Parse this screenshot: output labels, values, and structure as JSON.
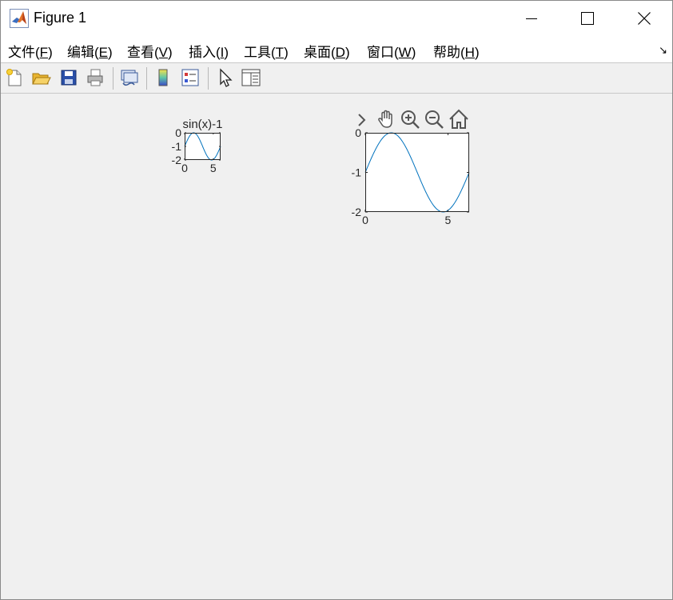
{
  "window": {
    "title": "Figure 1",
    "icon": "matlab-logo-icon",
    "controls": [
      "minimize-icon",
      "maximize-icon",
      "close-icon"
    ]
  },
  "menubar": {
    "items": [
      {
        "label": "文件(F)",
        "underline": "F"
      },
      {
        "label": "编辑(E)",
        "underline": "E"
      },
      {
        "label": "查看(V)",
        "underline": "V"
      },
      {
        "label": "插入(I)",
        "underline": "I"
      },
      {
        "label": "工具(T)",
        "underline": "T"
      },
      {
        "label": "桌面(D)",
        "underline": "D"
      },
      {
        "label": "窗口(W)",
        "underline": "W"
      },
      {
        "label": "帮助(H)",
        "underline": "H"
      }
    ],
    "dock_arrow": "↘"
  },
  "toolbar": {
    "buttons": [
      {
        "name": "new-figure",
        "icon": "new-file-icon"
      },
      {
        "name": "open-file",
        "icon": "folder-open-icon"
      },
      {
        "name": "save-figure",
        "icon": "save-icon"
      },
      {
        "name": "print-figure",
        "icon": "print-icon"
      },
      {
        "name": "link-plot",
        "icon": "link-plot-icon"
      },
      {
        "name": "insert-colorbar",
        "icon": "colorbar-icon"
      },
      {
        "name": "insert-legend",
        "icon": "legend-icon"
      },
      {
        "name": "edit-plot",
        "icon": "pointer-icon"
      },
      {
        "name": "property-inspector",
        "icon": "property-inspector-icon"
      }
    ]
  },
  "axes_toolbar": {
    "icons": [
      "chevron-right-icon",
      "pan-hand-icon",
      "zoom-in-icon",
      "zoom-out-icon",
      "home-icon"
    ]
  },
  "colors": {
    "line": "#0072bd",
    "axes_bg": "#ffffff",
    "figure_bg": "#f0f0f0",
    "axis_text": "#262626"
  },
  "chart_data": [
    {
      "type": "line",
      "title": "sin(x)-1",
      "xlabel": "",
      "ylabel": "",
      "xlim": [
        0,
        6.2832
      ],
      "ylim": [
        -2,
        0
      ],
      "xticks": [
        0,
        5
      ],
      "yticks": [
        0,
        -1,
        -2
      ],
      "xtick_labels": [
        "0",
        "5"
      ],
      "ytick_labels": [
        "0",
        "-1",
        "-2"
      ],
      "grid": false,
      "series": [
        {
          "function": "y = sin(x) - 1",
          "x": [
            0,
            0.5,
            1.0,
            1.5708,
            2.0,
            2.5,
            3.0,
            3.5,
            4.0,
            4.7124,
            5.0,
            5.5,
            6.0,
            6.2832
          ],
          "y": [
            -1.0,
            -0.5206,
            -0.1585,
            0.0,
            -0.0907,
            -0.4015,
            -0.8589,
            -1.3508,
            -1.7568,
            -2.0,
            -1.9589,
            -1.7055,
            -1.2794,
            -1.0
          ]
        }
      ]
    },
    {
      "type": "line",
      "title": "",
      "xlabel": "",
      "ylabel": "",
      "xlim": [
        0,
        6.2832
      ],
      "ylim": [
        -2,
        0
      ],
      "xticks": [
        0,
        5
      ],
      "yticks": [
        0,
        -1,
        -2
      ],
      "xtick_labels": [
        "0",
        "5"
      ],
      "ytick_labels": [
        "0",
        "-1",
        "-2"
      ],
      "grid": false,
      "series": [
        {
          "function": "y = sin(x) - 1",
          "x": [
            0,
            0.5,
            1.0,
            1.5708,
            2.0,
            2.5,
            3.0,
            3.5,
            4.0,
            4.7124,
            5.0,
            5.5,
            6.0,
            6.2832
          ],
          "y": [
            -1.0,
            -0.5206,
            -0.1585,
            0.0,
            -0.0907,
            -0.4015,
            -0.8589,
            -1.3508,
            -1.7568,
            -2.0,
            -1.9589,
            -1.7055,
            -1.2794,
            -1.0
          ]
        }
      ]
    }
  ]
}
